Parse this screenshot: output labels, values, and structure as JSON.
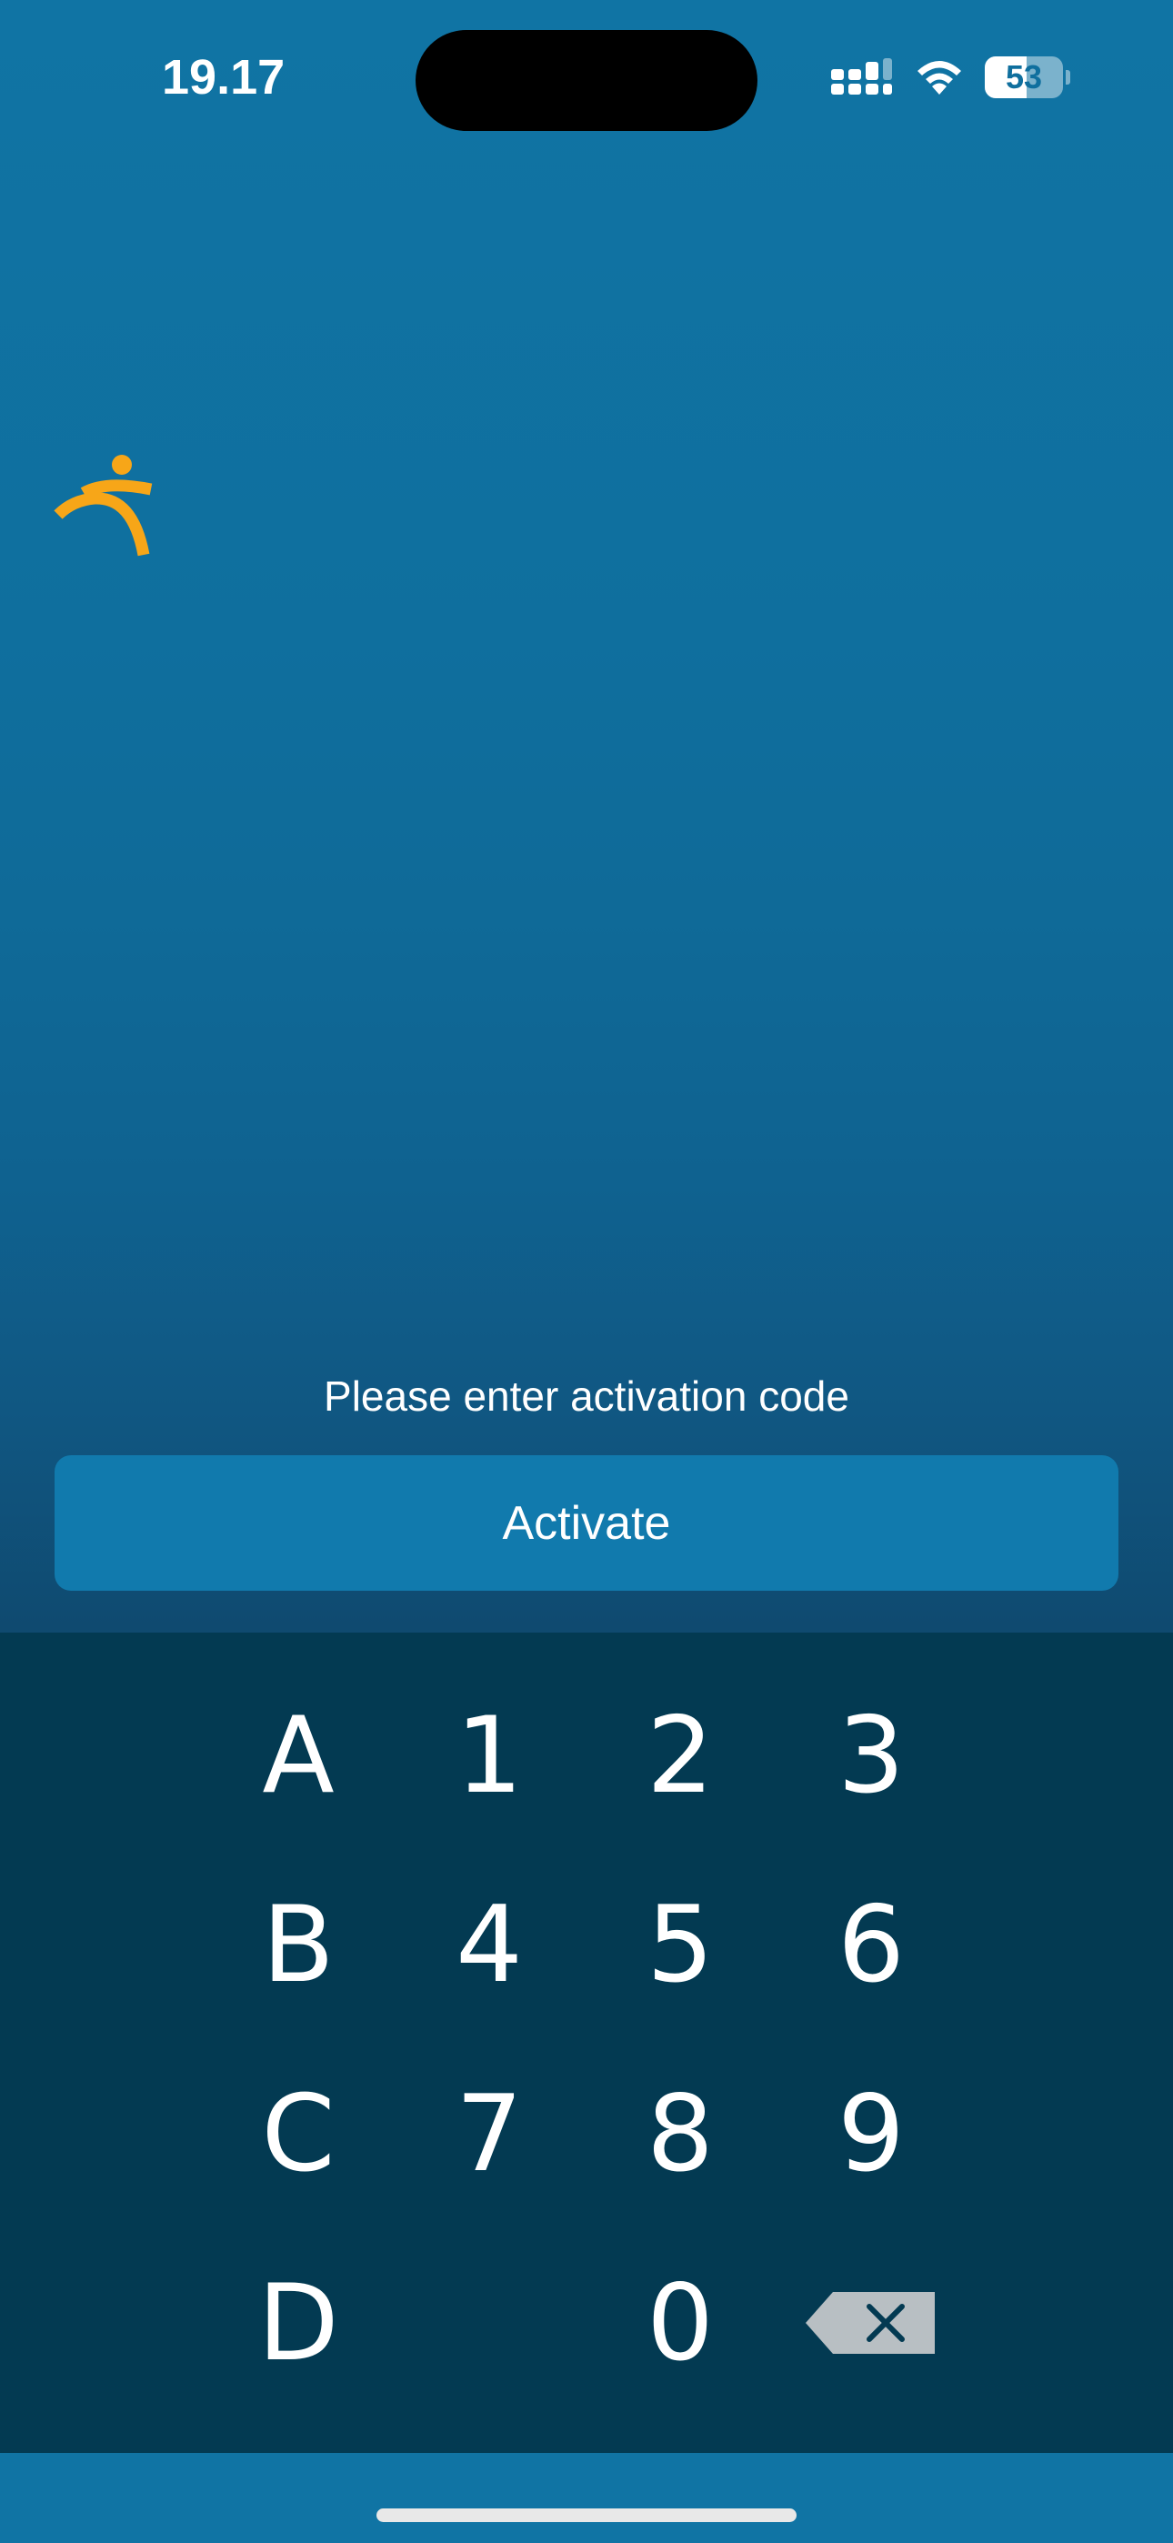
{
  "status_bar": {
    "time": "19.17",
    "battery_level": "53",
    "battery_fraction": 0.53,
    "icons": [
      "signal-icon",
      "wifi-icon",
      "battery-icon"
    ]
  },
  "logo": {
    "icon": "figure-logo-icon",
    "color": "#f7a618"
  },
  "activation": {
    "prompt": "Please enter activation code",
    "button_label": "Activate"
  },
  "keypad": {
    "rows": [
      [
        "A",
        "1",
        "2",
        "3"
      ],
      [
        "B",
        "4",
        "5",
        "6"
      ],
      [
        "C",
        "7",
        "8",
        "9"
      ],
      [
        "D",
        "",
        "0",
        "backspace"
      ]
    ],
    "labels": {
      "A": "A",
      "B": "B",
      "C": "C",
      "D": "D",
      "k1": "1",
      "k2": "2",
      "k3": "3",
      "k4": "4",
      "k5": "5",
      "k6": "6",
      "k7": "7",
      "k8": "8",
      "k9": "9",
      "k0": "0"
    },
    "backspace_icon": "backspace-icon"
  },
  "colors": {
    "background_top": "#1074a4",
    "keypad_background": "#033a52",
    "button_background": "#117aad",
    "accent": "#f7a618"
  }
}
